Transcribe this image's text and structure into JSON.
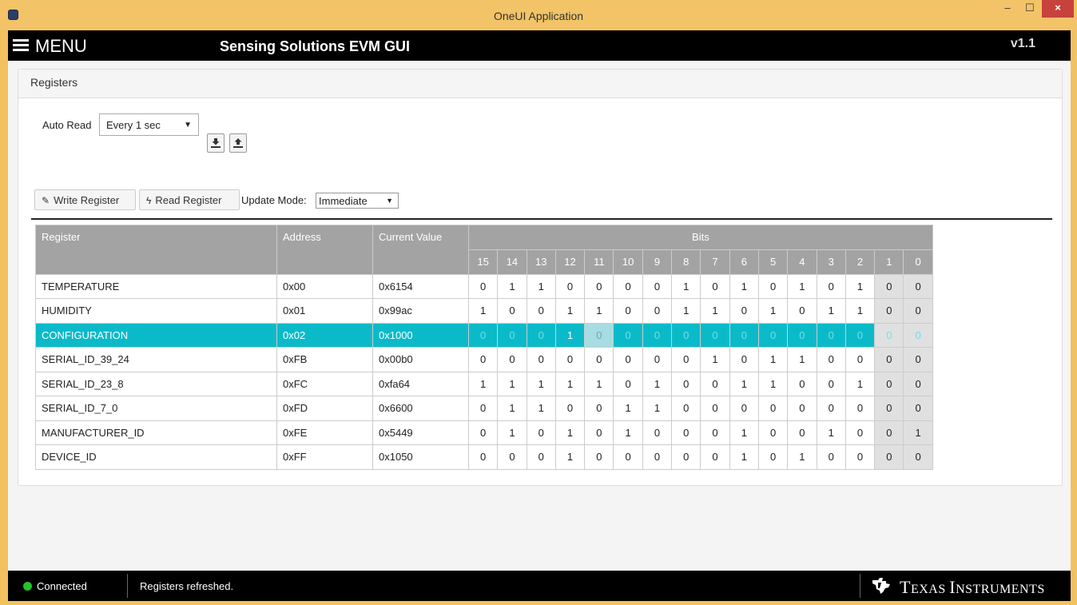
{
  "window": {
    "title": "OneUI Application",
    "min_glyph": "–",
    "max_glyph": "☐",
    "close_glyph": "×"
  },
  "header": {
    "menu_label": "MENU",
    "app_title": "Sensing Solutions EVM GUI",
    "version": "v1.1"
  },
  "panel": {
    "title": "Registers",
    "auto_read": {
      "label": "Auto Read",
      "value": "Every 1 sec"
    },
    "icons": [
      "download-icon",
      "upload-icon"
    ],
    "write_button": "Write Register",
    "read_button": "Read Register",
    "update_mode": {
      "label": "Update Mode:",
      "value": "Immediate"
    }
  },
  "table": {
    "headers": {
      "register": "Register",
      "address": "Address",
      "current_value": "Current Value",
      "bits": "Bits"
    },
    "bit_numbers": [
      "15",
      "14",
      "13",
      "12",
      "11",
      "10",
      "9",
      "8",
      "7",
      "6",
      "5",
      "4",
      "3",
      "2",
      "1",
      "0"
    ],
    "readonly_bits": [
      "1",
      "0"
    ],
    "selected_row": 2,
    "focused_bit": "11",
    "rows": [
      {
        "name": "TEMPERATURE",
        "address": "0x00",
        "value": "0x6154",
        "bits": [
          "0",
          "1",
          "1",
          "0",
          "0",
          "0",
          "0",
          "1",
          "0",
          "1",
          "0",
          "1",
          "0",
          "1",
          "0",
          "0"
        ]
      },
      {
        "name": "HUMIDITY",
        "address": "0x01",
        "value": "0x99ac",
        "bits": [
          "1",
          "0",
          "0",
          "1",
          "1",
          "0",
          "0",
          "1",
          "1",
          "0",
          "1",
          "0",
          "1",
          "1",
          "0",
          "0"
        ]
      },
      {
        "name": "CONFIGURATION",
        "address": "0x02",
        "value": "0x1000",
        "bits": [
          "0",
          "0",
          "0",
          "1",
          "0",
          "0",
          "0",
          "0",
          "0",
          "0",
          "0",
          "0",
          "0",
          "0",
          "0",
          "0"
        ]
      },
      {
        "name": "SERIAL_ID_39_24",
        "address": "0xFB",
        "value": "0x00b0",
        "bits": [
          "0",
          "0",
          "0",
          "0",
          "0",
          "0",
          "0",
          "0",
          "1",
          "0",
          "1",
          "1",
          "0",
          "0",
          "0",
          "0"
        ]
      },
      {
        "name": "SERIAL_ID_23_8",
        "address": "0xFC",
        "value": "0xfa64",
        "bits": [
          "1",
          "1",
          "1",
          "1",
          "1",
          "0",
          "1",
          "0",
          "0",
          "1",
          "1",
          "0",
          "0",
          "1",
          "0",
          "0"
        ]
      },
      {
        "name": "SERIAL_ID_7_0",
        "address": "0xFD",
        "value": "0x6600",
        "bits": [
          "0",
          "1",
          "1",
          "0",
          "0",
          "1",
          "1",
          "0",
          "0",
          "0",
          "0",
          "0",
          "0",
          "0",
          "0",
          "0"
        ]
      },
      {
        "name": "MANUFACTURER_ID",
        "address": "0xFE",
        "value": "0x5449",
        "bits": [
          "0",
          "1",
          "0",
          "1",
          "0",
          "1",
          "0",
          "0",
          "0",
          "1",
          "0",
          "0",
          "1",
          "0",
          "0",
          "1"
        ]
      },
      {
        "name": "DEVICE_ID",
        "address": "0xFF",
        "value": "0x1050",
        "bits": [
          "0",
          "0",
          "0",
          "1",
          "0",
          "0",
          "0",
          "0",
          "0",
          "1",
          "0",
          "1",
          "0",
          "0",
          "0",
          "0"
        ]
      }
    ]
  },
  "status": {
    "connection": "Connected",
    "message": "Registers refreshed.",
    "brand": "Texas Instruments",
    "brand_display": [
      "T",
      "EXAS ",
      "I",
      "NSTRUMENTS"
    ]
  },
  "colors": {
    "titlebar": "#f3c367",
    "selected_row": "#0bbac9",
    "connected": "#23c32a",
    "close_button": "#c7423c"
  }
}
